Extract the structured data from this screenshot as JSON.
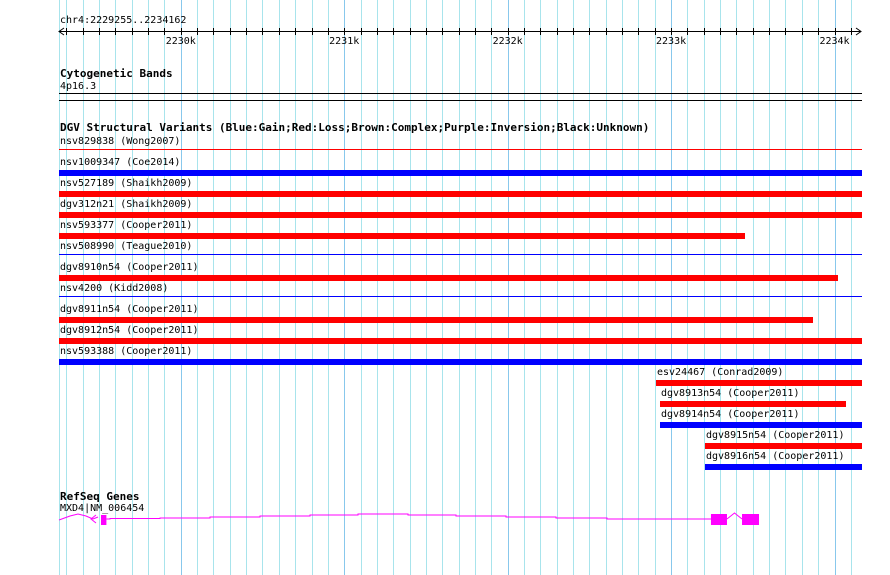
{
  "ruler": {
    "title": "chr4:2229255..2234162",
    "start": 2229255,
    "end": 2234162,
    "ticks": [
      {
        "value": 2230000,
        "label": "2230k"
      },
      {
        "value": 2231000,
        "label": "2231k"
      },
      {
        "value": 2232000,
        "label": "2232k"
      },
      {
        "value": 2233000,
        "label": "2233k"
      },
      {
        "value": 2234000,
        "label": "2234k"
      }
    ]
  },
  "cytoband": {
    "title": "Cytogenetic Bands",
    "band": "4p16.3"
  },
  "dgv": {
    "title": "DGV Structural Variants (Blue:Gain;Red:Loss;Brown:Complex;Purple:Inversion;Black:Unknown)",
    "colors": {
      "gain": "#0000ff",
      "loss": "#ff0000"
    },
    "variants": [
      {
        "label": "nsv829838 (Wong2007)",
        "type": "loss",
        "style": "thin",
        "start": 2229255,
        "end": 2234162
      },
      {
        "label": "nsv1009347 (Coe2014)",
        "type": "gain",
        "style": "thick",
        "start": 2229255,
        "end": 2234162
      },
      {
        "label": "nsv527189 (Shaikh2009)",
        "type": "loss",
        "style": "thick",
        "start": 2229255,
        "end": 2234162
      },
      {
        "label": "dgv312n21 (Shaikh2009)",
        "type": "loss",
        "style": "thick",
        "start": 2229255,
        "end": 2234162
      },
      {
        "label": "nsv593377 (Cooper2011)",
        "type": "loss",
        "style": "thick",
        "start": 2229255,
        "end": 2233446
      },
      {
        "label": "nsv508990 (Teague2010)",
        "type": "gain",
        "style": "thin",
        "start": 2229255,
        "end": 2234162
      },
      {
        "label": "dgv8910n54 (Cooper2011)",
        "type": "loss",
        "style": "thick",
        "start": 2229255,
        "end": 2234015
      },
      {
        "label": "nsv4200 (Kidd2008)",
        "type": "gain",
        "style": "thin",
        "start": 2229255,
        "end": 2234162
      },
      {
        "label": "dgv8911n54 (Cooper2011)",
        "type": "loss",
        "style": "thick",
        "start": 2229255,
        "end": 2233862
      },
      {
        "label": "dgv8912n54 (Cooper2011)",
        "type": "loss",
        "style": "thick",
        "start": 2229255,
        "end": 2234162
      },
      {
        "label": "nsv593388 (Cooper2011)",
        "type": "gain",
        "style": "thick",
        "start": 2229255,
        "end": 2234162
      },
      {
        "label": "esv24467 (Conrad2009)",
        "type": "loss",
        "style": "thick",
        "start": 2232908,
        "end": 2234162
      },
      {
        "label": "dgv8913n54 (Cooper2011)",
        "type": "loss",
        "style": "thick",
        "start": 2232932,
        "end": 2234064
      },
      {
        "label": "dgv8914n54 (Cooper2011)",
        "type": "gain",
        "style": "thick",
        "start": 2232932,
        "end": 2234162
      },
      {
        "label": "dgv8915n54 (Cooper2011)",
        "type": "loss",
        "style": "thick",
        "start": 2233207,
        "end": 2234162
      },
      {
        "label": "dgv8916n54 (Cooper2011)",
        "type": "gain",
        "style": "thick",
        "start": 2233207,
        "end": 2234162
      }
    ]
  },
  "refseq": {
    "title": "RefSeq Genes",
    "gene_label": "MXD4|NM_006454",
    "color": "#ff00ff",
    "exons": [
      [
        2229512,
        2229545
      ],
      [
        2233244,
        2233342
      ],
      [
        2233434,
        2233538
      ]
    ]
  }
}
